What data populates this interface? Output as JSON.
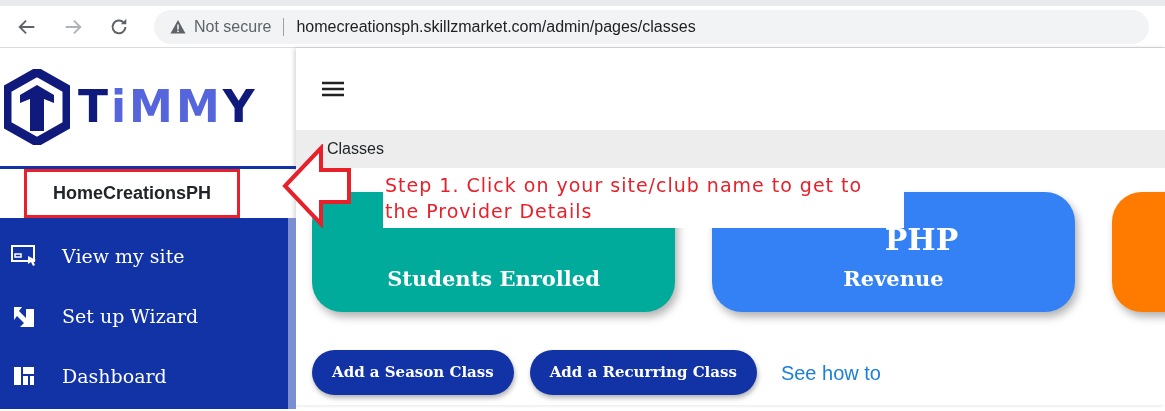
{
  "browser": {
    "security_label": "Not secure",
    "url": "homecreationsph.skillzmarket.com/admin/pages/classes"
  },
  "sidebar": {
    "logo_text": "TiMMY",
    "site_name": "HomeCreationsPH",
    "items": [
      {
        "label": "View my site"
      },
      {
        "label": "Set up Wizard"
      },
      {
        "label": "Dashboard"
      }
    ]
  },
  "breadcrumb": "Classes",
  "stats": [
    {
      "label": "Students Enrolled",
      "color": "#00ab9b"
    },
    {
      "value": "PHP",
      "label": "Revenue",
      "color": "#3381f5"
    },
    {
      "color": "#ff7b00"
    }
  ],
  "actions": [
    {
      "kind": "button",
      "label": "Add a Season Class"
    },
    {
      "kind": "button",
      "label": "Add a Recurring Class"
    },
    {
      "kind": "link",
      "label": "See how to"
    }
  ],
  "annotation": {
    "text": "Step 1. Click on your site/club name to get to the Provider Details"
  }
}
